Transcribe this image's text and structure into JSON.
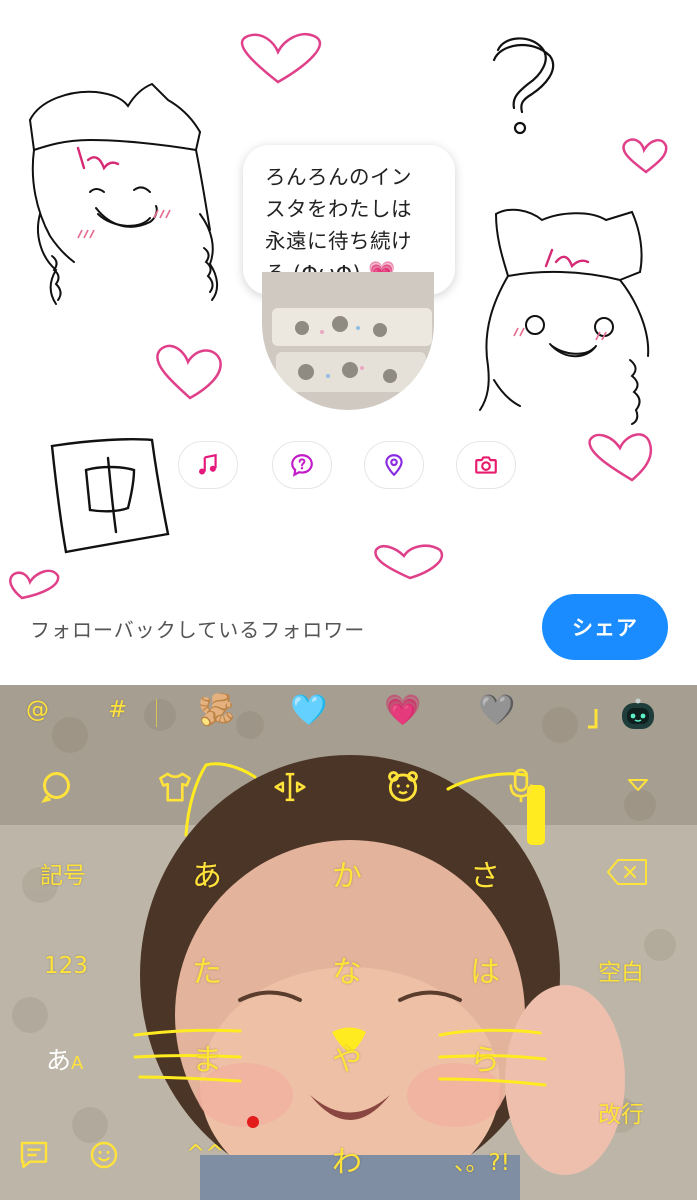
{
  "story": {
    "bubble_lines": [
      "ろんろんのイン",
      "スタをわたしは",
      "永遠に待ち続け",
      "る (ΦωΦ) "
    ],
    "bubble_emoji": "💗",
    "doodle_kanji": "中",
    "doodle_question": "?",
    "chips": [
      {
        "name": "music",
        "icon": "music-note-icon",
        "color": "#e5197b"
      },
      {
        "name": "question",
        "icon": "question-bubble-icon",
        "color": "#c21ac9"
      },
      {
        "name": "location",
        "icon": "location-pin-icon",
        "color": "#8a2be2"
      },
      {
        "name": "camera",
        "icon": "camera-icon",
        "color": "#e81b6d"
      }
    ]
  },
  "footer": {
    "followers_label": "フォローバックしているフォロワー",
    "share_label": "シェア"
  },
  "keyboard": {
    "accent_color": "#ffe23a",
    "top_row": {
      "at": "@",
      "hash": "#",
      "emojis": [
        "🫚",
        "🩵",
        "💗",
        "🩶"
      ]
    },
    "toolbar_icons": [
      "search-icon",
      "shirt-icon",
      "cursor-move-icon",
      "bear-face-icon",
      "microphone-icon",
      "dropdown-triangle-icon"
    ],
    "rows": [
      {
        "left": "記号",
        "keys": [
          "あ",
          "か",
          "さ"
        ],
        "right": "backspace-icon"
      },
      {
        "left": "123",
        "keys": [
          "た",
          "な",
          "は"
        ],
        "right": "空白"
      },
      {
        "left_main": "あ",
        "left_sub": "A",
        "keys": [
          "ま",
          "や",
          "ら"
        ],
        "right": "改行"
      },
      {
        "left": "comment-icon",
        "keys": [
          "^^",
          "わ",
          "、。?!"
        ],
        "right": ""
      }
    ]
  }
}
